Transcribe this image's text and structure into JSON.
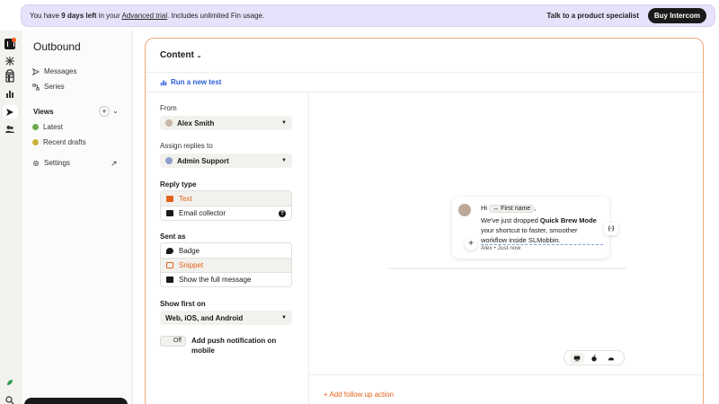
{
  "banner": {
    "text_prefix": "You have ",
    "days": "9 days left",
    "text_mid": " in your ",
    "trial_link": "Advanced trial",
    "text_suffix": ". Includes unlimited Fin usage.",
    "specialist_link": "Talk to a product specialist",
    "buy_button": "Buy Intercom"
  },
  "sidebar": {
    "title": "Outbound",
    "items": [
      {
        "label": "Messages",
        "icon": "send-icon"
      },
      {
        "label": "Series",
        "icon": "series-icon"
      }
    ],
    "views_title": "Views",
    "views": [
      {
        "label": "Latest",
        "icon": "green-dot-icon"
      },
      {
        "label": "Recent drafts",
        "icon": "yellow-dot-icon"
      }
    ],
    "settings": "Settings"
  },
  "content": {
    "title": "Content",
    "ab_test": "Run a new test",
    "from_label": "From",
    "from_value": "Alex Smith",
    "assign_label": "Assign replies to",
    "assign_value": "Admin Support",
    "reply_type_label": "Reply type",
    "reply_types": [
      {
        "label": "Text",
        "selected": true
      },
      {
        "label": "Email collector",
        "selected": false
      }
    ],
    "sent_as_label": "Sent as",
    "sent_as": [
      {
        "label": "Badge",
        "selected": false
      },
      {
        "label": "Snippet",
        "selected": true
      },
      {
        "label": "Show the full message",
        "selected": false
      }
    ],
    "show_first_label": "Show first on",
    "show_first_value": "Web, iOS, and Android",
    "push_toggle": "Off",
    "push_label": "Add push notification on mobile",
    "follow_up": "+ Add follow up action"
  },
  "preview": {
    "greeting": "Hi",
    "chip": "First name",
    "comma": ",",
    "line2_prefix": "We've just dropped ",
    "line2_bold": "Quick Brew Mode",
    "line3": "your shortcut to faster, smoother",
    "line4": "workflow inside SLMobbin.",
    "meta": "Alex • Just now",
    "var_button": "{-}"
  },
  "colors": {
    "accent": "#e2621b",
    "link": "#2a5bd7",
    "banner_bg": "#e6e2fb",
    "panel_border": "#f4a877"
  }
}
